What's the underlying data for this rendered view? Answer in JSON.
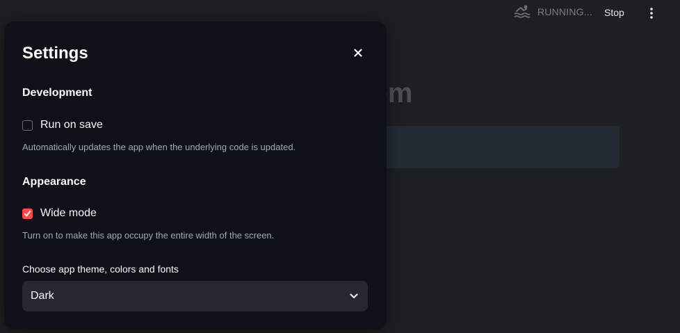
{
  "header": {
    "status_text": "RUNNING...",
    "stop_label": "Stop",
    "menu_icon": "more-vertical-icon",
    "status_icon": "swimmer-icon"
  },
  "background": {
    "title_fragment": "stem"
  },
  "settings": {
    "title": "Settings",
    "close_icon": "close-icon",
    "development": {
      "heading": "Development",
      "run_on_save_label": "Run on save",
      "run_on_save_checked": false,
      "run_on_save_help": "Automatically updates the app when the underlying code is updated."
    },
    "appearance": {
      "heading": "Appearance",
      "wide_mode_label": "Wide mode",
      "wide_mode_checked": true,
      "wide_mode_help": "Turn on to make this app occupy the entire width of the screen."
    },
    "theme": {
      "label": "Choose app theme, colors and fonts",
      "selected": "Dark"
    }
  },
  "colors": {
    "accent": "#ff4b4b",
    "dialog_bg": "#0e1117",
    "page_bg": "#1e1f22"
  }
}
